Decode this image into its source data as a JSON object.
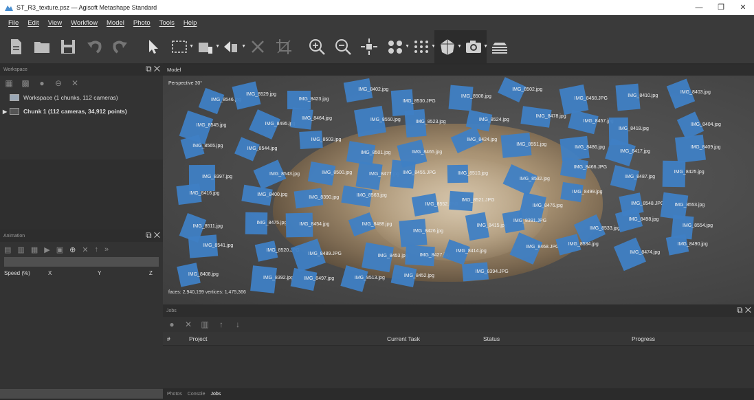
{
  "window": {
    "title": "ST_R3_texture.psz — Agisoft Metashape Standard",
    "minimize": "—",
    "maximize": "❐",
    "close": "✕"
  },
  "menu": [
    "File",
    "Edit",
    "View",
    "Workflow",
    "Model",
    "Photo",
    "Tools",
    "Help"
  ],
  "workspace": {
    "panel_title": "Workspace",
    "root": "Workspace (1 chunks, 112 cameras)",
    "chunk": "Chunk 1 (112 cameras, 34,912 points)"
  },
  "animation": {
    "panel_title": "Animation",
    "columns": [
      "Speed (%)",
      "X",
      "Y",
      "Z"
    ]
  },
  "model_view": {
    "tab": "Model",
    "projection": "Perspective 30°",
    "stats": "faces: 2,940,199 vertices: 1,475,366",
    "cameras": [
      "IMG_8546.jpg",
      "IMG_8529.jpg",
      "IMG_8423.jpg",
      "IMG_8402.jpg",
      "IMG_8530.JPG",
      "IMG_8508.jpg",
      "IMG_8502.jpg",
      "IMG_8458.JPG",
      "IMG_8410.jpg",
      "IMG_8403.jpg",
      "IMG_8545.jpg",
      "IMG_8495.jpg",
      "IMG_8464.jpg",
      "IMG_8550.jpg",
      "IMG_8523.jpg",
      "IMG_8524.jpg",
      "IMG_8478.jpg",
      "IMG_8457.jpg",
      "IMG_8418.jpg",
      "IMG_8404.jpg",
      "IMG_8565.jpg",
      "IMG_8544.jpg",
      "IMG_8503.jpg",
      "IMG_8501.jpg",
      "IMG_8465.jpg",
      "IMG_8424.jpg",
      "IMG_8551.jpg",
      "IMG_8486.jpg",
      "IMG_8417.jpg",
      "IMG_8409.jpg",
      "IMG_8397.jpg",
      "IMG_8543.jpg",
      "IMG_8500.jpg",
      "IMG_8477.jpg",
      "IMG_8455.JPG",
      "IMG_8510.jpg",
      "IMG_8532.jpg",
      "IMG_8466.JPG",
      "IMG_8487.jpg",
      "IMG_8425.jpg",
      "IMG_8416.jpg",
      "IMG_8400.jpg",
      "IMG_8390.jpg",
      "IMG_8563.jpg",
      "IMG_8552.JPG",
      "IMG_8521.JPG",
      "IMG_8476.jpg",
      "IMG_8499.jpg",
      "IMG_8548.JPG",
      "IMG_8553.jpg",
      "IMG_8511.jpg",
      "IMG_8475.jpg",
      "IMG_8454.jpg",
      "IMG_8488.jpg",
      "IMG_8426.jpg",
      "IMG_8415.jpg",
      "IMG_8391.JPG",
      "IMG_8533.jpg",
      "IMG_8498.jpg",
      "IMG_8554.jpg",
      "IMG_8541.jpg",
      "IMG_8520.JPG",
      "IMG_8489.JPG",
      "IMG_8453.jpg",
      "IMG_8427.jpg",
      "IMG_8414.jpg",
      "IMG_8468.JPG",
      "IMG_8534.jpg",
      "IMG_8474.jpg",
      "IMG_8490.jpg",
      "IMG_8408.jpg",
      "IMG_8392.jpg",
      "IMG_8497.jpg",
      "IMG_8513.jpg",
      "IMG_8452.jpg",
      "IMG_8394.JPG"
    ]
  },
  "jobs": {
    "panel_title": "Jobs",
    "columns": [
      "#",
      "Project",
      "Current Task",
      "Status",
      "Progress"
    ]
  },
  "bottom_tabs": [
    "Photos",
    "Console",
    "Jobs"
  ],
  "colors": {
    "camera": "#3f7fc4",
    "panel": "#333333",
    "toolbar": "#3a3a3a"
  }
}
